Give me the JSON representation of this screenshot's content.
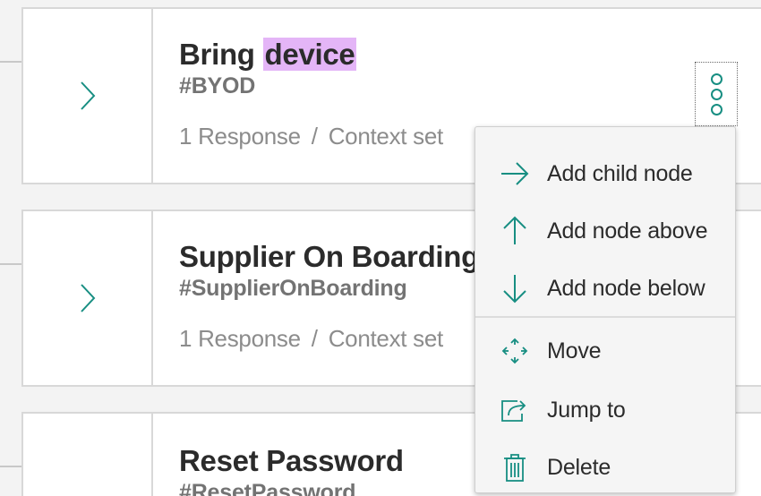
{
  "colors": {
    "accent": "#178e82",
    "highlight": "#e4b5f7"
  },
  "nodes": [
    {
      "title_before": "Bring ",
      "title_highlight": "device",
      "title": "",
      "tag": "#BYOD",
      "responses": "1 Response",
      "separator": "/",
      "context": "Context set"
    },
    {
      "title": "Supplier On Boarding",
      "tag": "#SupplierOnBoarding",
      "responses": "1 Response",
      "separator": "/",
      "context": "Context set"
    },
    {
      "title": "Reset Password",
      "tag": "#ResetPassword"
    }
  ],
  "menu": {
    "items": [
      {
        "label": "Add child node",
        "icon": "arrow-right-icon"
      },
      {
        "label": "Add node above",
        "icon": "arrow-up-icon"
      },
      {
        "label": "Add node below",
        "icon": "arrow-down-icon"
      },
      {
        "label": "Move",
        "icon": "move-icon"
      },
      {
        "label": "Jump to",
        "icon": "jump-to-icon"
      },
      {
        "label": "Delete",
        "icon": "trash-icon"
      }
    ]
  }
}
